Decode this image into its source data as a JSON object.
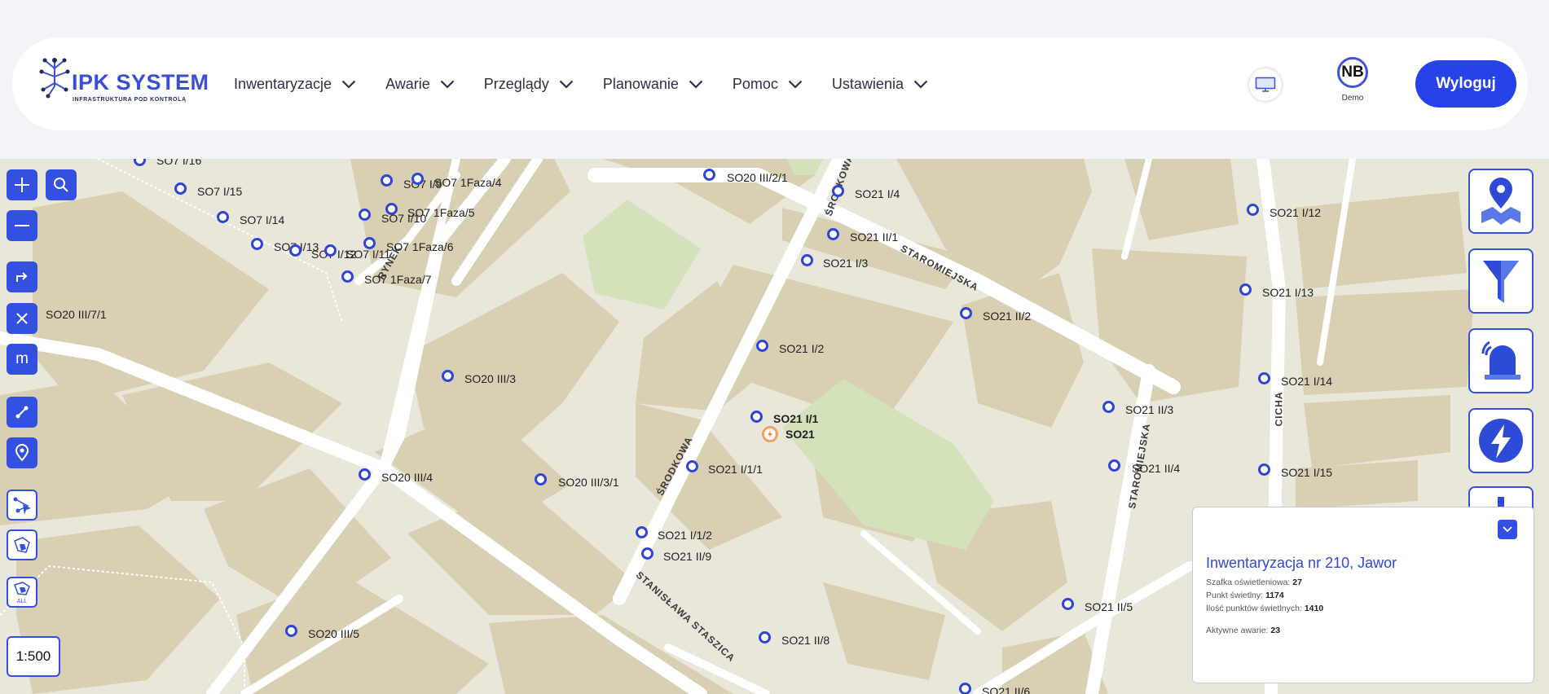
{
  "header": {
    "logo_title": "IPK SYSTEM",
    "logo_subtitle": "INFRASTRUKTURA POD KONTROLĄ",
    "nav": [
      {
        "label": "Inwentaryzacje"
      },
      {
        "label": "Awarie"
      },
      {
        "label": "Przeglądy"
      },
      {
        "label": "Planowanie"
      },
      {
        "label": "Pomoc"
      },
      {
        "label": "Ustawienia"
      }
    ],
    "user_initials": "NB",
    "user_name": "Demo",
    "logout_label": "Wyloguj"
  },
  "map": {
    "scale": "1:500",
    "points": [
      "SO7 I/16",
      "SO7 I/15",
      "SO7 I/14",
      "SO7 I/13",
      "SO7 I/12",
      "SO7 I/11",
      "SO7 I/9",
      "SO7 1Faza/4",
      "SO7 1Faza/5",
      "SO7 I/10",
      "SO7 1Faza/6",
      "SO7 1Faza/7",
      "SO20 III/7/1",
      "SO20 III/2/1",
      "SO21 I/4",
      "SO21 II/1",
      "SO21 I/3",
      "SO21 II/2",
      "SO21 I/2",
      "SO20 III/3",
      "SO21 I/1",
      "SO21",
      "SO21 I/1/1",
      "SO20 III/4",
      "SO20 III/3/1",
      "SO21 I/1/2",
      "SO21 II/9",
      "SO21 II/8",
      "SO20 III/5",
      "SO21 II/3",
      "SO21 II/4",
      "SO21 II/5",
      "SO21 II/6",
      "SO21 I/12",
      "SO21 I/13",
      "SO21 I/14",
      "SO21 I/15"
    ],
    "streets": [
      "ŚRODKOWA",
      "STAROMIEJSKA",
      "RYNEK",
      "ŚRODKOWA",
      "STAROMIEJSKA",
      "STANISŁAWA STASZICA",
      "CICHA"
    ]
  },
  "info_panel": {
    "title": "Inwentaryzacja nr 210, Jawor",
    "rows": [
      {
        "label": "Szafka oświetleniowa:",
        "value": "27"
      },
      {
        "label": "Punkt świetlny:",
        "value": "1174"
      },
      {
        "label": "Ilość punktów świetlnych:",
        "value": "1410"
      },
      {
        "label": "Aktywne awarie:",
        "value": "23"
      }
    ]
  },
  "colors": {
    "accent": "#3350e0",
    "building": "#d9cfb3",
    "road": "#ffffff",
    "park": "#d3e2bb",
    "ground": "#e9e6da"
  }
}
